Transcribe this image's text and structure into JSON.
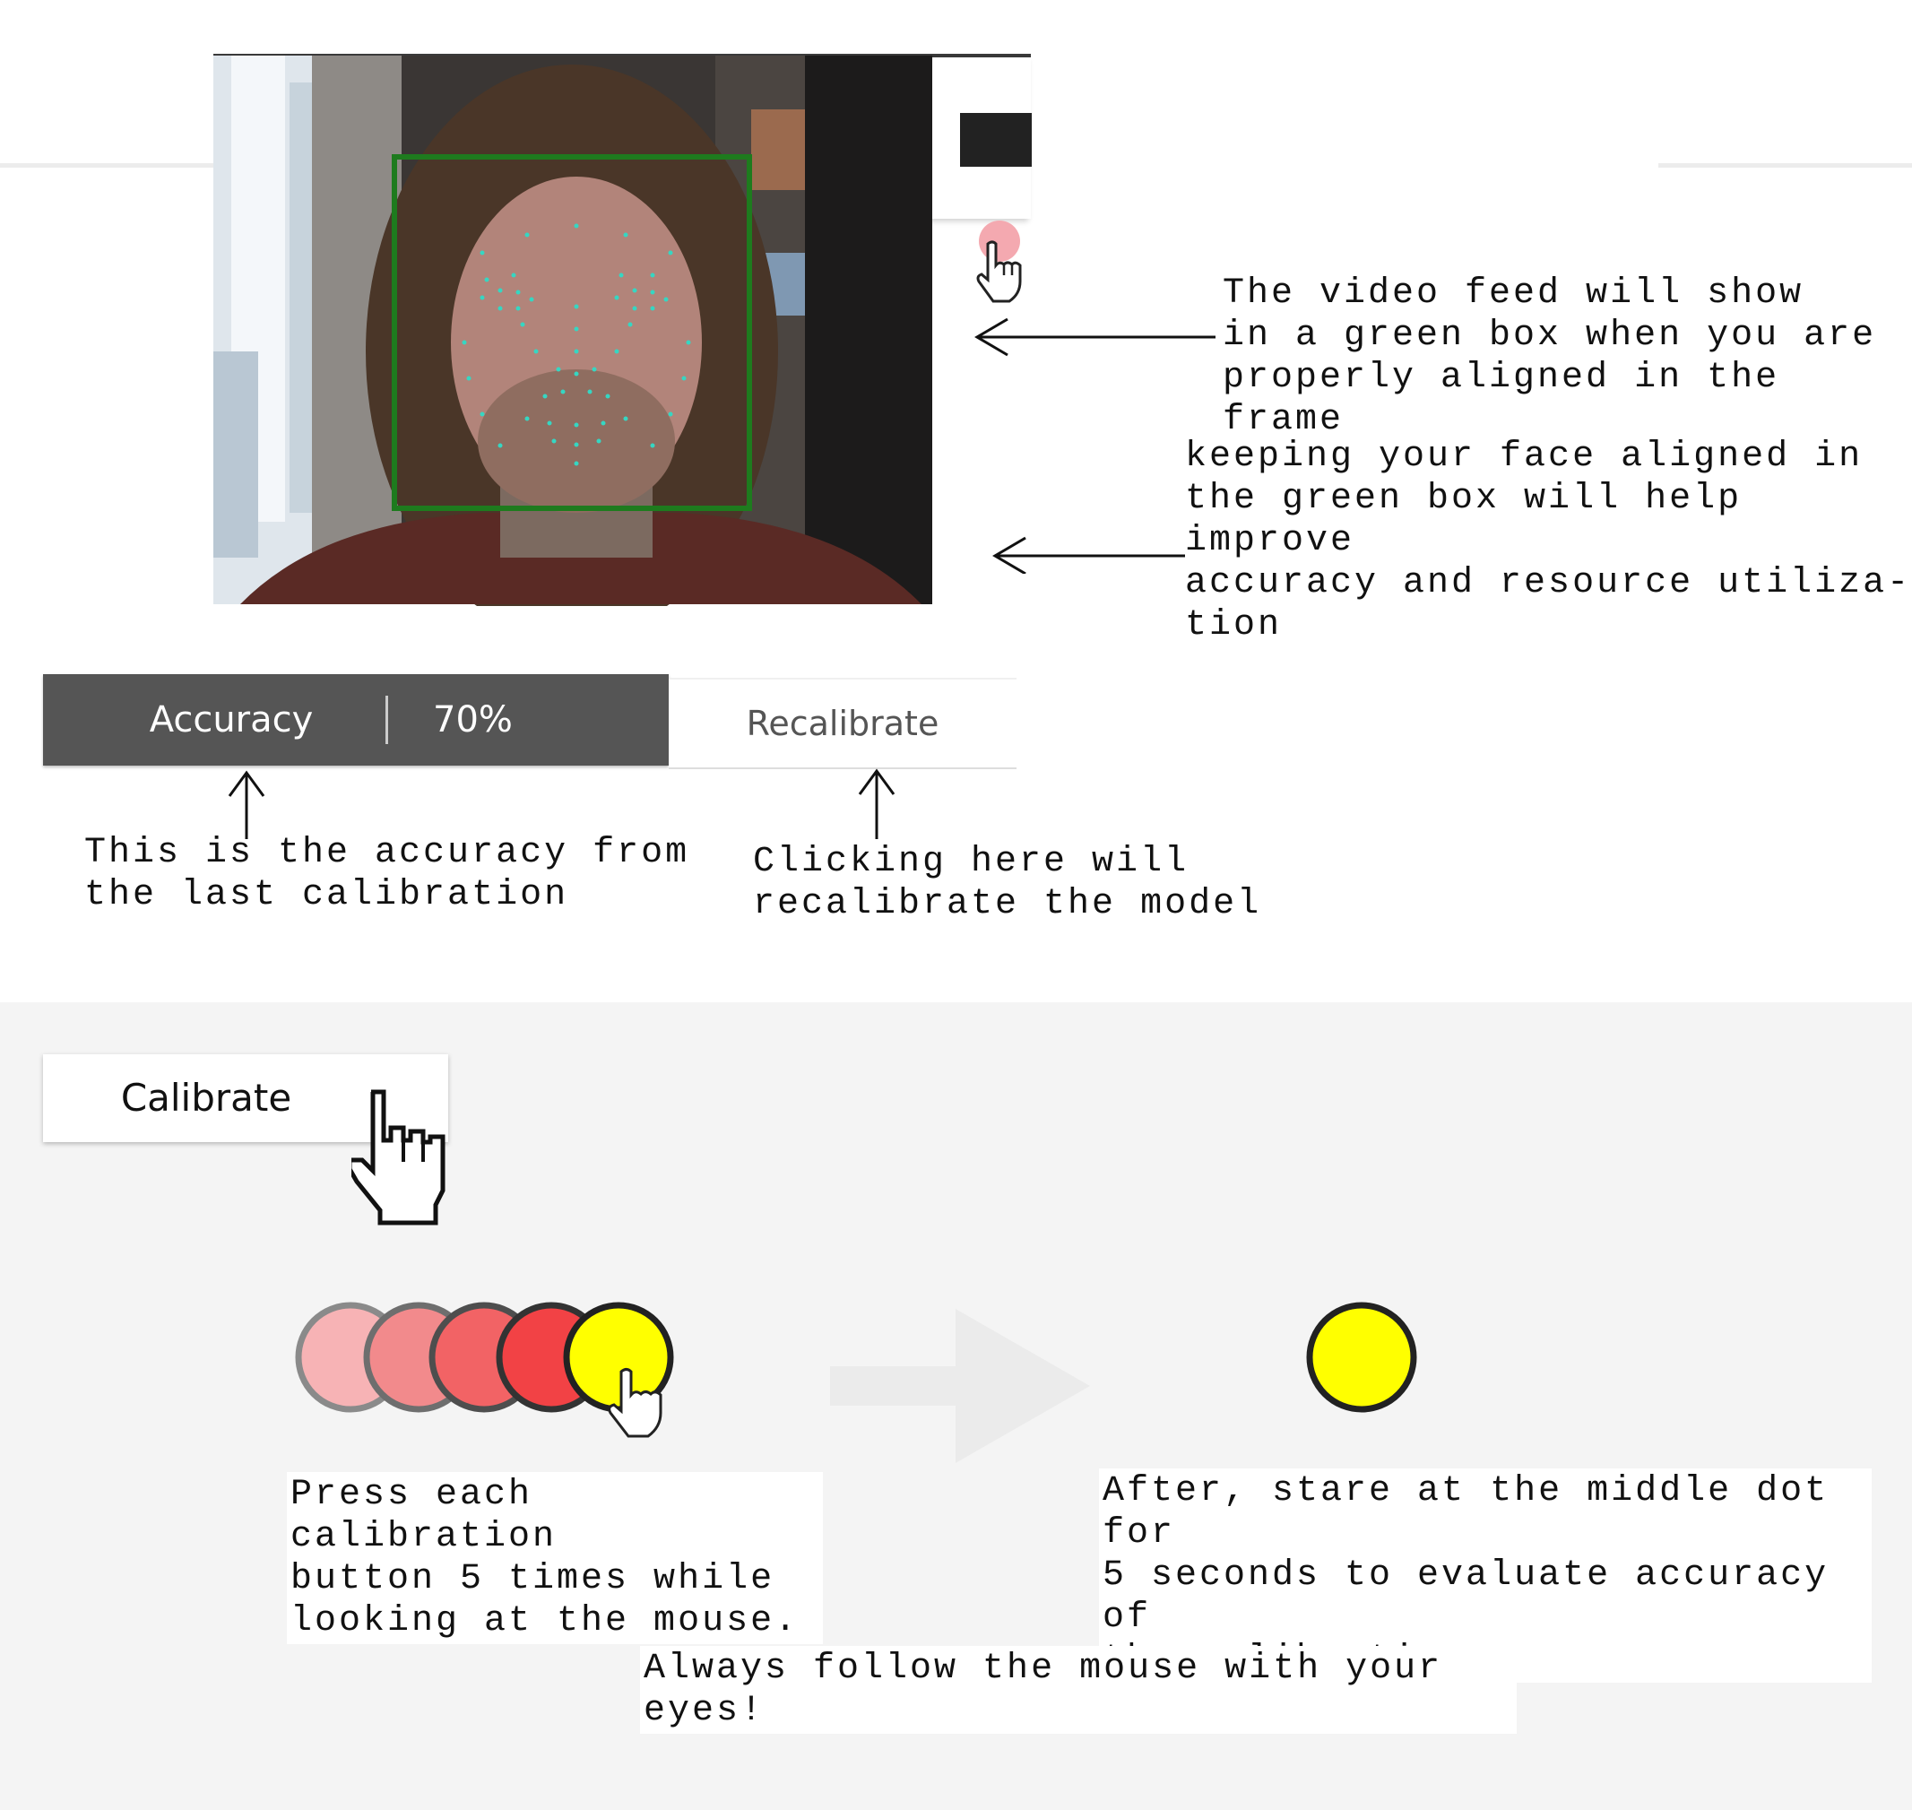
{
  "video": {
    "annotation_top": "The video feed will show\nin a green box when you are\nproperly aligned in the frame",
    "annotation_bottom": "keeping your face aligned in\nthe green box will help improve\naccuracy and resource utiliza-\ntion"
  },
  "accuracy_bar": {
    "label": "Accuracy",
    "value": "70%",
    "annotation": "This is the accuracy from\nthe last calibration"
  },
  "recalibrate": {
    "label": "Recalibrate",
    "annotation": "Clicking here will\nrecalibrate the model"
  },
  "calibration": {
    "button_label": "Calibrate",
    "press_instruction": "Press each calibration\nbutton 5 times while\nlooking at the mouse.",
    "stare_instruction": "After, stare at the middle dot for\n5 seconds to evaluate accuracy of\nthe calibration",
    "footer": "Always follow the mouse with your eyes!",
    "dot_colors": [
      "#f7b3b5",
      "#f28a8c",
      "#f26365",
      "#f24245",
      "#ffff00"
    ],
    "target_color": "#ffff00"
  },
  "colors": {
    "face_box": "#1e7b1e",
    "landmarks": "#36d6c2",
    "accuracy_bg": "#555555"
  }
}
